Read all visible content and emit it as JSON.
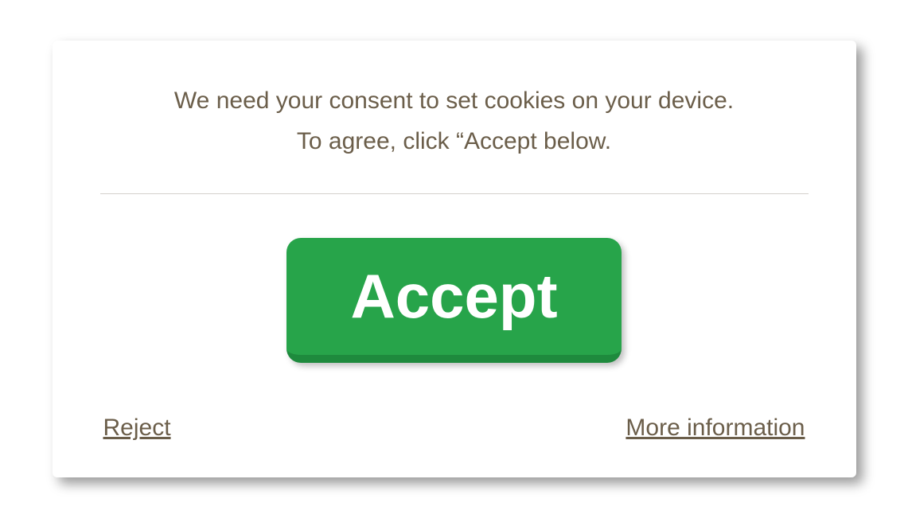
{
  "dialog": {
    "message_line1": "We need your consent to set cookies on your device.",
    "message_line2": "To agree, click “Accept below.",
    "accept_label": "Accept",
    "reject_label": "Reject",
    "more_info_label": "More information"
  }
}
